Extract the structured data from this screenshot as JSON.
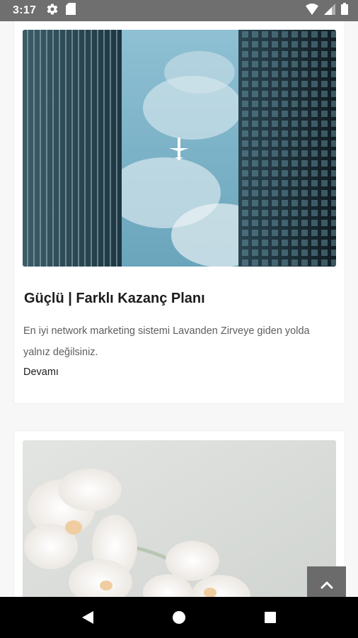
{
  "status_bar": {
    "time": "3:17",
    "icons": [
      "gear-icon",
      "sd-card-icon",
      "wifi-icon",
      "signal-icon",
      "battery-icon"
    ]
  },
  "cards": [
    {
      "title": "Güçlü | Farklı Kazanç Planı",
      "excerpt": "En iyi network marketing sistemi Lavanden Zirveye giden yolda yalnız değilsiniz.",
      "read_more": "Devamı",
      "image": "skyscrapers-airplane-photo"
    },
    {
      "image": "white-orchids-photo"
    }
  ],
  "scroll_top_icon": "chevron-up-icon",
  "nav": {
    "icons": [
      "back-icon",
      "home-icon",
      "recents-icon"
    ]
  },
  "colors": {
    "status_bar": "#6f6f6f",
    "page_bg": "#f7f7f7",
    "scroll_button": "#6b6b6b",
    "nav_bar": "#000000"
  }
}
